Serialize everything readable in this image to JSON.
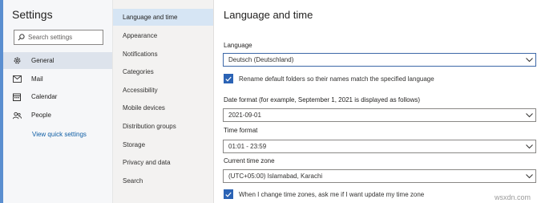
{
  "settings": {
    "title": "Settings",
    "search_placeholder": "Search settings",
    "nav": [
      {
        "label": "General",
        "icon": "gear-icon",
        "active": true
      },
      {
        "label": "Mail",
        "icon": "mail-icon"
      },
      {
        "label": "Calendar",
        "icon": "calendar-icon"
      },
      {
        "label": "People",
        "icon": "people-icon"
      }
    ],
    "quick_settings": "View quick settings"
  },
  "categories": [
    "Language and time",
    "Appearance",
    "Notifications",
    "Categories",
    "Accessibility",
    "Mobile devices",
    "Distribution groups",
    "Storage",
    "Privacy and data",
    "Search"
  ],
  "panel": {
    "title": "Language and time",
    "language_label": "Language",
    "language_value": "Deutsch (Deutschland)",
    "rename_folders": "Rename default folders so their names match the specified language",
    "date_format_label": "Date format (for example, September 1, 2021 is displayed as follows)",
    "date_format_value": "2021-09-01",
    "time_format_label": "Time format",
    "time_format_value": "01:01 - 23:59",
    "timezone_label": "Current time zone",
    "timezone_value": "(UTC+05:00) Islamabad, Karachi",
    "timezone_prompt": "When I change time zones, ask me if I want update my time zone"
  },
  "watermark": "wsxdn.com",
  "colors": {
    "accent": "#2b63b5",
    "selected": "#d6e5f4",
    "link": "#0f5ea5"
  }
}
